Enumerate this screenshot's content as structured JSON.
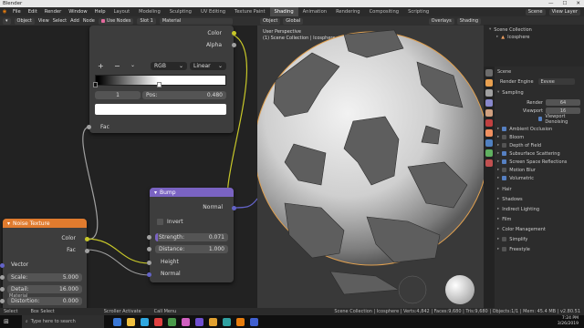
{
  "window": {
    "title": "Blender"
  },
  "menu": {
    "items": [
      "File",
      "Edit",
      "Render",
      "Window",
      "Help"
    ],
    "workspaces": [
      "Layout",
      "Modeling",
      "Sculpting",
      "UV Editing",
      "Texture Paint",
      "Shading",
      "Animation",
      "Rendering",
      "Compositing",
      "Scripting"
    ],
    "active_workspace": "Shading",
    "scene": "Scene",
    "view_layer": "View Layer"
  },
  "node_editor": {
    "header": {
      "mode": "Object",
      "view": "View",
      "select": "Select",
      "add": "Add",
      "node": "Node",
      "use_nodes": "Use Nodes",
      "slot": "Slot 1",
      "material": "Material"
    },
    "color_ramp": {
      "out_color": "Color",
      "out_alpha": "Alpha",
      "mode": "RGB",
      "interpolation": "Linear",
      "add": "+",
      "remove": "−",
      "menu": "⌄",
      "index": "1",
      "pos_label": "Pos:",
      "pos_value": "0.480",
      "in_fac": "Fac"
    },
    "bump": {
      "title": "Bump",
      "out_normal": "Normal",
      "invert": "Invert",
      "strength_label": "Strength:",
      "strength_value": "0.071",
      "distance_label": "Distance:",
      "distance_value": "1.000",
      "in_height": "Height",
      "in_normal": "Normal"
    },
    "noise": {
      "title": "Noise Texture",
      "out_color": "Color",
      "out_fac": "Fac",
      "in_vector": "Vector",
      "scale_label": "Scale:",
      "scale_value": "5.000",
      "detail_label": "Detail:",
      "detail_value": "16.000",
      "distortion_label": "Distortion:",
      "distortion_value": "0.000"
    },
    "footer_label": "Material"
  },
  "viewport": {
    "header": {
      "mode": "Object",
      "orientation": "Global",
      "overlays": "Overlays",
      "shading": "Shading"
    },
    "info_line1": "User Perspective",
    "info_line2": "(1) Scene Collection | Icosphere"
  },
  "outliner": {
    "root": "Scene Collection",
    "child": "Icosphere"
  },
  "properties": {
    "scene": "Scene",
    "render_engine_label": "Render Engine",
    "render_engine": "Eevee",
    "sampling": "Sampling",
    "render_label": "Render",
    "render_value": "64",
    "viewport_label": "Viewport",
    "viewport_value": "16",
    "viewport_denoising": "Viewport Denoising",
    "panels": [
      {
        "label": "Ambient Occlusion",
        "checked": true
      },
      {
        "label": "Bloom",
        "checked": false
      },
      {
        "label": "Depth of Field",
        "checked": false
      },
      {
        "label": "Subsurface Scattering",
        "checked": true
      },
      {
        "label": "Screen Space Reflections",
        "checked": true
      },
      {
        "label": "Motion Blur",
        "checked": false
      },
      {
        "label": "Volumetric",
        "checked": true
      },
      {
        "label": "Hair",
        "checked": false
      },
      {
        "label": "Shadows",
        "checked": false
      },
      {
        "label": "Indirect Lighting",
        "checked": false
      },
      {
        "label": "Film",
        "checked": false
      },
      {
        "label": "Color Management",
        "checked": false
      },
      {
        "label": "Simplify",
        "checked": false
      },
      {
        "label": "Freestyle",
        "checked": false
      }
    ]
  },
  "statusbar": {
    "select": "Select",
    "box_select": "Box Select",
    "scroller": "Scroller Activate",
    "call_menu": "Call Menu",
    "stats": "Scene Collection | Icosphere | Verts:4,842 | Faces:9,680 | Tris:9,680 | Objects:1/1 | Mem: 45.4 MB | v2.80.51"
  },
  "taskbar": {
    "search": "Type here to search",
    "time": "7:24 PM",
    "date": "3/26/2019"
  },
  "colors": {
    "bump_header": "#7a63c2",
    "noise_header": "#e07b2e",
    "accent": "#e87d0d"
  }
}
